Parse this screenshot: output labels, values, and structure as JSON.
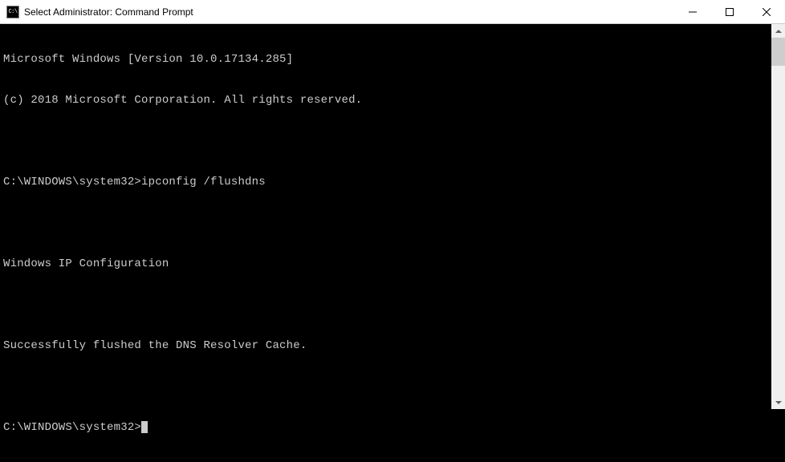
{
  "window": {
    "title": "Select Administrator: Command Prompt",
    "icon_text": "C:\\"
  },
  "terminal": {
    "lines": [
      "Microsoft Windows [Version 10.0.17134.285]",
      "(c) 2018 Microsoft Corporation. All rights reserved.",
      "",
      "C:\\WINDOWS\\system32>ipconfig /flushdns",
      "",
      "Windows IP Configuration",
      "",
      "Successfully flushed the DNS Resolver Cache.",
      ""
    ],
    "prompt": "C:\\WINDOWS\\system32>"
  }
}
